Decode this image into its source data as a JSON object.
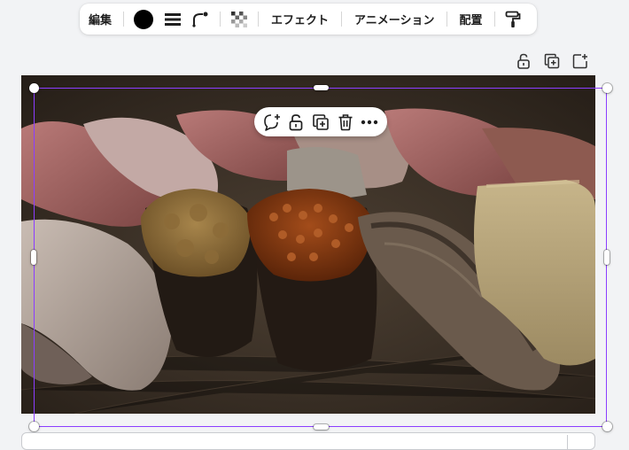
{
  "toolbar": {
    "edit_label": "編集",
    "color_swatch": "#000000",
    "effects_label": "エフェクト",
    "animation_label": "アニメーション",
    "position_label": "配置"
  },
  "page_actions": {
    "icons": [
      "lock-icon",
      "duplicate-page-icon",
      "add-page-icon"
    ]
  },
  "floating_menu": {
    "icons": [
      "comment-icon",
      "lock-icon",
      "duplicate-icon",
      "trash-icon",
      "more-icon"
    ]
  },
  "canvas": {
    "image": "sushi-photo",
    "selection_color": "#8b3dff"
  }
}
